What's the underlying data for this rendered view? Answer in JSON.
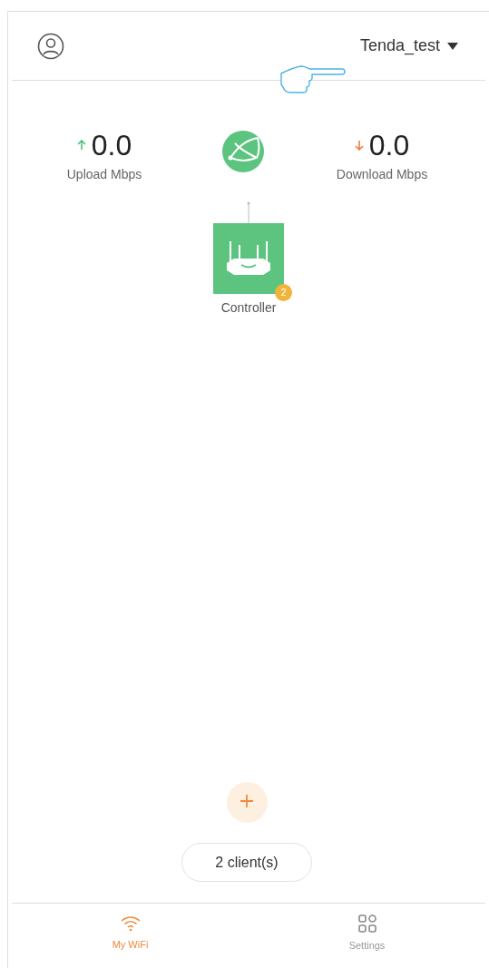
{
  "header": {
    "network_name": "Tenda_test"
  },
  "stats": [
    {
      "kind": "upload",
      "value": "0.0",
      "label": "Upload Mbps"
    },
    {
      "kind": "download",
      "value": "0.0",
      "label": "Download Mbps"
    }
  ],
  "controller": {
    "label": "Controller",
    "badge": "2"
  },
  "clients_button": "2 client(s)",
  "tabs": [
    {
      "kind": "wifi",
      "label": "My WiFi",
      "selected": true
    },
    {
      "kind": "settings",
      "label": "Settings",
      "selected": false
    }
  ]
}
